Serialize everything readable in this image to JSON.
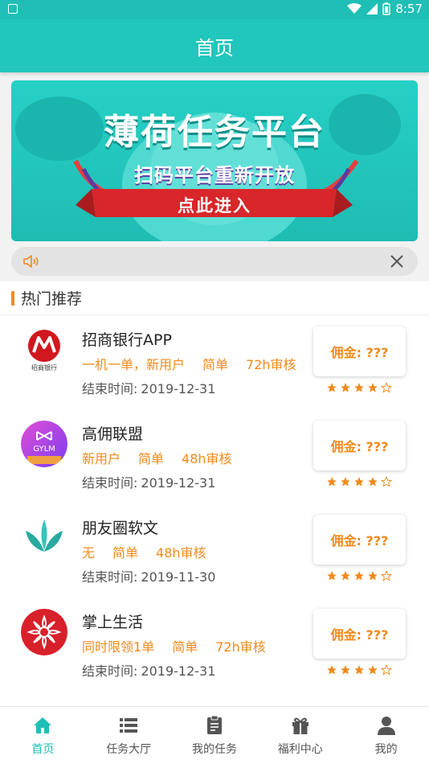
{
  "status_bar": {
    "time": "8:57"
  },
  "header": {
    "title": "首页"
  },
  "banner": {
    "title": "薄荷任务平台",
    "subtitle": "扫码平台重新开放",
    "ribbon": "点此进入"
  },
  "section": {
    "title": "热门推荐"
  },
  "tasks": [
    {
      "name": "招商银行APP",
      "tags": [
        "一机一单，新用户",
        "简单",
        "72h审核"
      ],
      "end_label": "结束时间:",
      "end_date": "2019-12-31",
      "commission": "佣金: ???",
      "rating": 4,
      "logo_text": "招商银行"
    },
    {
      "name": "高佣联盟",
      "tags": [
        "新用户",
        "简单",
        "48h审核"
      ],
      "end_label": "结束时间:",
      "end_date": "2019-12-31",
      "commission": "佣金: ???",
      "rating": 4,
      "logo_text": "GYLM"
    },
    {
      "name": "朋友圈软文",
      "tags": [
        "无",
        "简单",
        "48h审核"
      ],
      "end_label": "结束时间:",
      "end_date": "2019-11-30",
      "commission": "佣金: ???",
      "rating": 4,
      "logo_text": ""
    },
    {
      "name": "掌上生活",
      "tags": [
        "同时限领1单",
        "简单",
        "72h审核"
      ],
      "end_label": "结束时间:",
      "end_date": "2019-12-31",
      "commission": "佣金: ???",
      "rating": 4,
      "logo_text": ""
    }
  ],
  "tabbar": {
    "items": [
      {
        "label": "首页",
        "icon": "home-icon",
        "active": true
      },
      {
        "label": "任务大厅",
        "icon": "list-icon",
        "active": false
      },
      {
        "label": "我的任务",
        "icon": "clipboard-icon",
        "active": false
      },
      {
        "label": "福利中心",
        "icon": "gift-icon",
        "active": false
      },
      {
        "label": "我的",
        "icon": "person-icon",
        "active": false
      }
    ]
  },
  "colors": {
    "accent": "#21c6bc",
    "orange": "#f08a1c"
  }
}
